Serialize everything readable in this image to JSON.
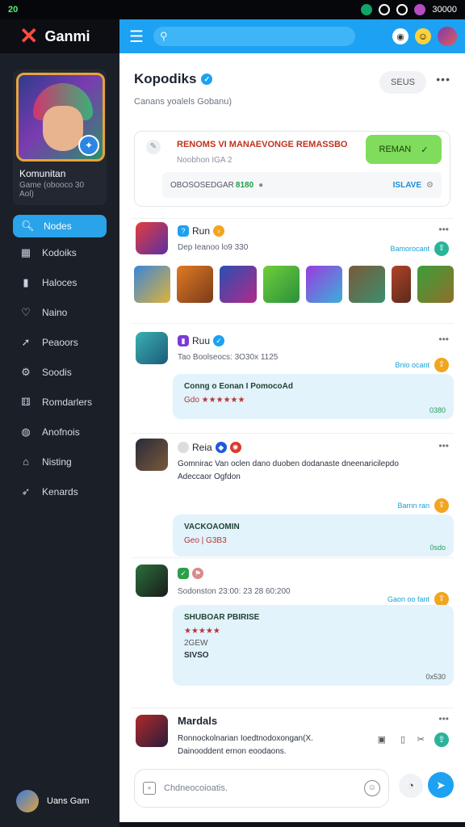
{
  "status": {
    "left": "20",
    "right_text": "30000"
  },
  "brand": {
    "name": "Ganmi"
  },
  "profile": {
    "title": "Komunitan",
    "subtitle": "Game (obooco 30 Aol)"
  },
  "nav": {
    "items": [
      {
        "label": "Nodes",
        "icon": "search-icon"
      },
      {
        "label": "Kodoiks",
        "icon": "grid-icon"
      },
      {
        "label": "Haloces",
        "icon": "folder-icon"
      },
      {
        "label": "Naino",
        "icon": "heart-icon"
      },
      {
        "label": "Peaoors",
        "icon": "pin-icon"
      },
      {
        "label": "Soodis",
        "icon": "gear-icon"
      },
      {
        "label": "Romdarlers",
        "icon": "dice-icon"
      },
      {
        "label": "Anofnois",
        "icon": "globe-icon"
      },
      {
        "label": "Nisting",
        "icon": "shelf-icon"
      },
      {
        "label": "Kenards",
        "icon": "arrow-icon"
      }
    ]
  },
  "me": {
    "name": "Uans Gam"
  },
  "topbar": {
    "search_placeholder": ""
  },
  "header": {
    "title": "Kopodiks",
    "subtitle": "Canans yoalels Gobanu)",
    "button": "SEUS"
  },
  "card": {
    "alert": "RENOMS VI MANAEVONGE REMASSBO",
    "sub": "Noobhon IGA 2",
    "green_label": "REMAN",
    "bar_text": "OBOSOSEDGAR",
    "bar_green": "8180",
    "bar_blue": "ISLAVE"
  },
  "posts": [
    {
      "name": "Run",
      "meta": "Dep Ieanoo lo9 330",
      "tag": "Bamorocant"
    },
    {
      "name": "Ruu",
      "meta": "Tao Boolseocs: 3O30x 1125",
      "tag": "Bnio ocant",
      "bubble_title": "Conng o Eonan I PomocoAd",
      "bubble_line": "Gdo ★★★★★★",
      "bubble_time": "0380"
    },
    {
      "name": "Reia",
      "text1": "Gomnirac Van oclen dano duoben dodanaste dneenaricilepdo",
      "text2": "Adeccaor Ogfdon",
      "tag": "Barnn ran",
      "bubble_title": "VACKOAOMIN",
      "bubble_line": "Geo | G3B3",
      "bubble_time": "0sdo"
    },
    {
      "name": "",
      "meta": "Sodonston 23:00: 23 28 60:200",
      "tag": "Gaon oo fant",
      "bubble_title": "SHUBOAR PBIRISE",
      "bubble_line": "★★★★★",
      "bubble_line2": "2GEW",
      "bubble_line3": "SIVSO",
      "bubble_time": "0x530"
    },
    {
      "name": "Mardals",
      "text1": "Ronnockolnarian Ioedtnodoxongan(X.",
      "text2": "Dainooddent ernon eoodaons."
    }
  ],
  "composer": {
    "placeholder": "Chdneocoioatis."
  }
}
